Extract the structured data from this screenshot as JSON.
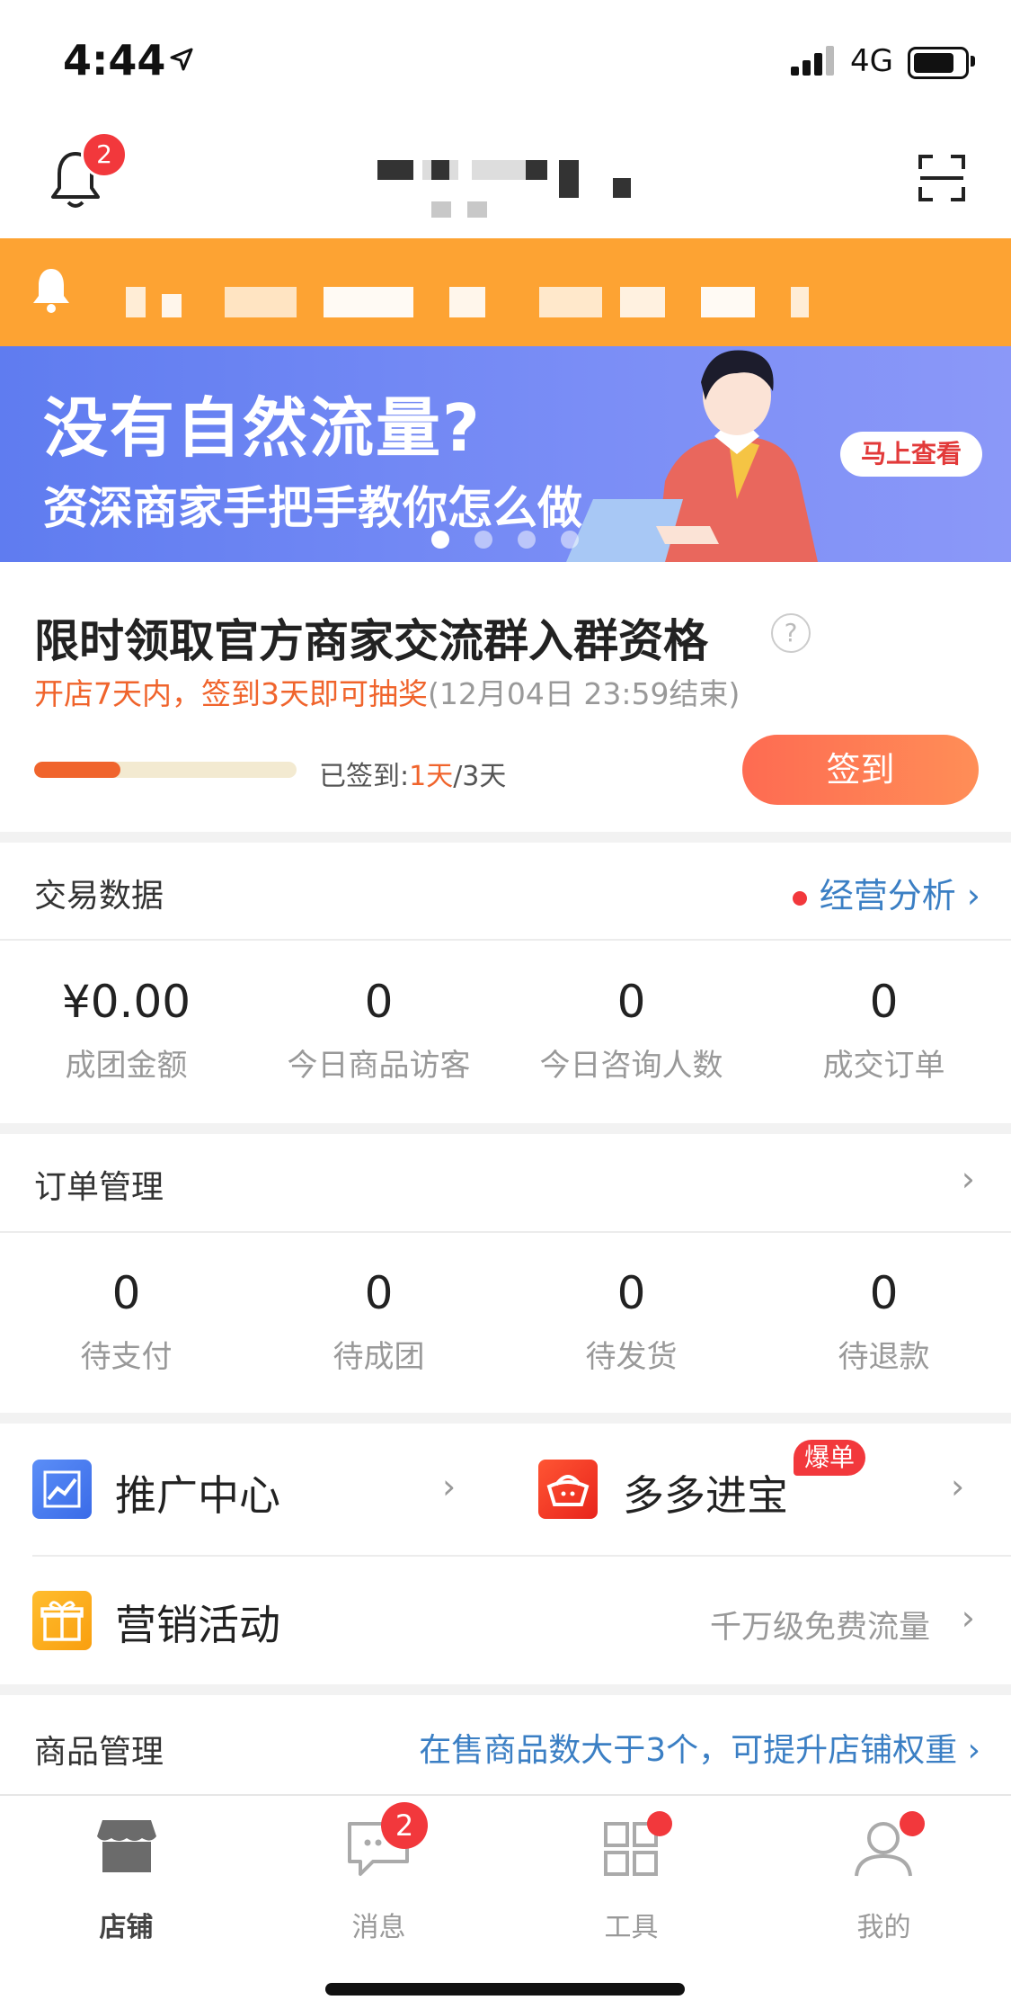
{
  "status_bar": {
    "time": "4:44",
    "network": "4G"
  },
  "header": {
    "notification_count": "2"
  },
  "banner": {
    "title": "没有自然流量?",
    "subtitle": "资深商家手把手教你怎么做",
    "button": "马上查看"
  },
  "signin": {
    "title": "限时领取官方商家交流群入群资格",
    "help": "?",
    "sub_highlight": "开店7天内，签到3天即可抽奖",
    "sub_deadline": "(12月04日 23:59结束)",
    "progress_prefix": "已签到:",
    "progress_current": "1天",
    "progress_total": "/3天",
    "progress_fraction": 0.33,
    "button": "签到"
  },
  "trade": {
    "title": "交易数据",
    "link": "经营分析",
    "stats": [
      {
        "value": "¥0.00",
        "label": "成团金额"
      },
      {
        "value": "0",
        "label": "今日商品访客"
      },
      {
        "value": "0",
        "label": "今日咨询人数"
      },
      {
        "value": "0",
        "label": "成交订单"
      }
    ]
  },
  "orders": {
    "title": "订单管理",
    "stats": [
      {
        "value": "0",
        "label": "待支付"
      },
      {
        "value": "0",
        "label": "待成团"
      },
      {
        "value": "0",
        "label": "待发货"
      },
      {
        "value": "0",
        "label": "待退款"
      }
    ]
  },
  "entries": {
    "promotion": "推广中心",
    "duoduo": "多多进宝",
    "duoduo_tag": "爆单",
    "marketing": "营销活动",
    "marketing_hint": "千万级免费流量"
  },
  "goods": {
    "title": "商品管理",
    "hint": "在售商品数大于3个，可提升店铺权重"
  },
  "tabs": [
    {
      "label": "店铺"
    },
    {
      "label": "消息",
      "badge": "2"
    },
    {
      "label": "工具"
    },
    {
      "label": "我的"
    }
  ],
  "colors": {
    "accent": "#f0642c",
    "link": "#3b7fc4",
    "notice": "#fda333",
    "badge": "#f2383c"
  }
}
